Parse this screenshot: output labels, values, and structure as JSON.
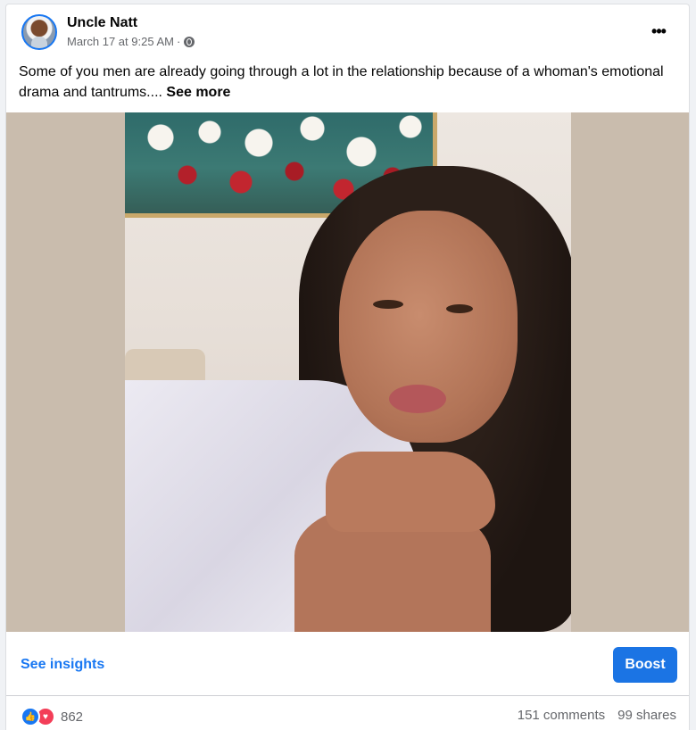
{
  "post": {
    "author": "Uncle Natt",
    "timestamp": "March 17 at 9:25 AM",
    "separator": "·",
    "privacy_icon": "globe-icon",
    "more_icon": "more-options-icon",
    "more_label": "•••",
    "text": "Some of you men are already going through a lot in the relationship because of a whoman's emotional drama and tantrums.... ",
    "see_more": "See more"
  },
  "actions": {
    "insights_label": "See insights",
    "boost_label": "Boost"
  },
  "stats": {
    "reactions_count": "862",
    "reaction_icons": [
      "like-icon",
      "love-icon"
    ],
    "comments": "151 comments",
    "shares": "99 shares"
  },
  "colors": {
    "brand": "#1877f2",
    "boost": "#1b74e4",
    "love": "#f33e58",
    "secondary_text": "#65676b"
  }
}
